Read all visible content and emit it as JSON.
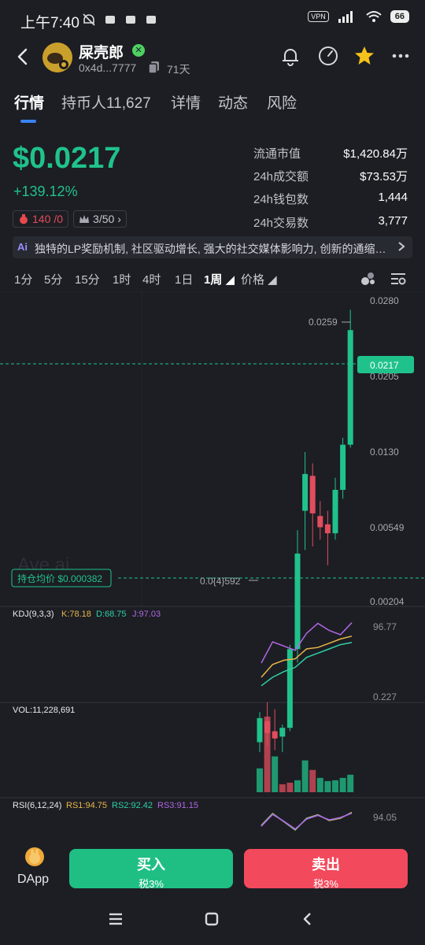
{
  "status": {
    "time": "上午7:40",
    "vpn": "VPN",
    "battery": "66"
  },
  "header": {
    "token_name": "屎壳郎",
    "address": "0x4d...7777",
    "age": "71天"
  },
  "tabs": [
    {
      "label": "行情"
    },
    {
      "label": "持币人11,627"
    },
    {
      "label": "详情"
    },
    {
      "label": "动态"
    },
    {
      "label": "风险"
    }
  ],
  "market": {
    "price": "$0.0217",
    "change": "+139.12%",
    "badge_count_left": "140",
    "badge_count_right": "/0",
    "badge_rank": "3/50"
  },
  "stats": [
    {
      "label": "流通市值",
      "value": "$1,420.84万"
    },
    {
      "label": "24h成交额",
      "value": "$73.53万"
    },
    {
      "label": "24h钱包数",
      "value": "1,444"
    },
    {
      "label": "24h交易数",
      "value": "3,777"
    }
  ],
  "intro": {
    "ai_label": "Ai",
    "text": "独特的LP奖励机制, 社区驱动增长, 强大的社交媒体影响力, 创新的通缩…"
  },
  "intervals": [
    "1分",
    "5分",
    "15分",
    "1时",
    "4时",
    "1日",
    "1周",
    "价格"
  ],
  "chart_data": [
    {
      "type": "candlestick",
      "interval": "1周",
      "y_axis_ticks": [
        "0.0280",
        "0.0205",
        "0.0130",
        "0.00549",
        "0.00204"
      ],
      "y_scale": "log",
      "current_price_label": "0.0217",
      "high_label": "0.0259",
      "low_label": "0.0{4}592",
      "avg_cost_label": "持仓均价 $0.000382",
      "watermark": "Ave.ai",
      "candles": [
        {
          "open": 0.0006,
          "high": 0.00078,
          "low": 0.00055,
          "close": 0.00074
        },
        {
          "open": 0.00072,
          "high": 0.00085,
          "low": 0.00058,
          "close": 0.00065
        },
        {
          "open": 0.00066,
          "high": 0.0008,
          "low": 0.00056,
          "close": 0.00062
        },
        {
          "open": 0.00063,
          "high": 0.0007,
          "low": 0.00055,
          "close": 0.00068
        },
        {
          "open": 0.00068,
          "high": 0.0014,
          "low": 0.00066,
          "close": 0.00135
        },
        {
          "open": 0.00135,
          "high": 0.0038,
          "low": 0.0012,
          "close": 0.0031
        },
        {
          "open": 0.0045,
          "high": 0.0075,
          "low": 0.0032,
          "close": 0.0062
        },
        {
          "open": 0.0061,
          "high": 0.0068,
          "low": 0.0033,
          "close": 0.0044
        },
        {
          "open": 0.0043,
          "high": 0.0049,
          "low": 0.0035,
          "close": 0.0039
        },
        {
          "open": 0.004,
          "high": 0.0045,
          "low": 0.0028,
          "close": 0.0037
        },
        {
          "open": 0.0037,
          "high": 0.006,
          "low": 0.0035,
          "close": 0.0054
        },
        {
          "open": 0.0054,
          "high": 0.0085,
          "low": 0.005,
          "close": 0.008
        },
        {
          "open": 0.008,
          "high": 0.0259,
          "low": 0.0078,
          "close": 0.0217
        }
      ]
    },
    {
      "type": "line",
      "name": "KDJ(9,3,3)",
      "series": [
        {
          "name": "K:78.18",
          "color": "#e8b54a",
          "values": [
            20,
            38,
            44,
            46,
            60,
            62,
            68,
            74,
            78
          ]
        },
        {
          "name": "D:68.75",
          "color": "#2fd0a8",
          "values": [
            8,
            20,
            28,
            34,
            48,
            54,
            60,
            66,
            69
          ]
        },
        {
          "name": "J:97.03",
          "color": "#b366e6",
          "values": [
            40,
            70,
            64,
            58,
            82,
            96,
            86,
            80,
            97
          ]
        }
      ],
      "axis_labels": [
        "96.77",
        "0.227"
      ]
    },
    {
      "type": "bar",
      "name": "VOL:11,228,691",
      "values": [
        30,
        95,
        45,
        10,
        12,
        15,
        40,
        28,
        18,
        14,
        15,
        18,
        22
      ],
      "colors": [
        "up",
        "down",
        "up",
        "down",
        "down",
        "up",
        "up",
        "down",
        "up",
        "up",
        "up",
        "up",
        "up"
      ]
    },
    {
      "type": "line",
      "name": "RSI(6,12,24)",
      "series": [
        {
          "name": "RS1:94.75",
          "color": "#e8b54a",
          "values": [
            40,
            90,
            55,
            20,
            70,
            85,
            60,
            70,
            95
          ]
        },
        {
          "name": "RS2:92.42",
          "color": "#2fd0a8",
          "values": [
            38,
            88,
            56,
            22,
            68,
            83,
            62,
            72,
            92
          ]
        },
        {
          "name": "RS3:91.15",
          "color": "#b366e6",
          "values": [
            36,
            86,
            57,
            24,
            66,
            82,
            63,
            73,
            91
          ]
        }
      ],
      "axis_labels": [
        "94.05"
      ]
    }
  ],
  "actions": {
    "dapp_label": "DApp",
    "buy_label": "买入",
    "buy_tax": "税3%",
    "sell_label": "卖出",
    "sell_tax": "税3%"
  }
}
